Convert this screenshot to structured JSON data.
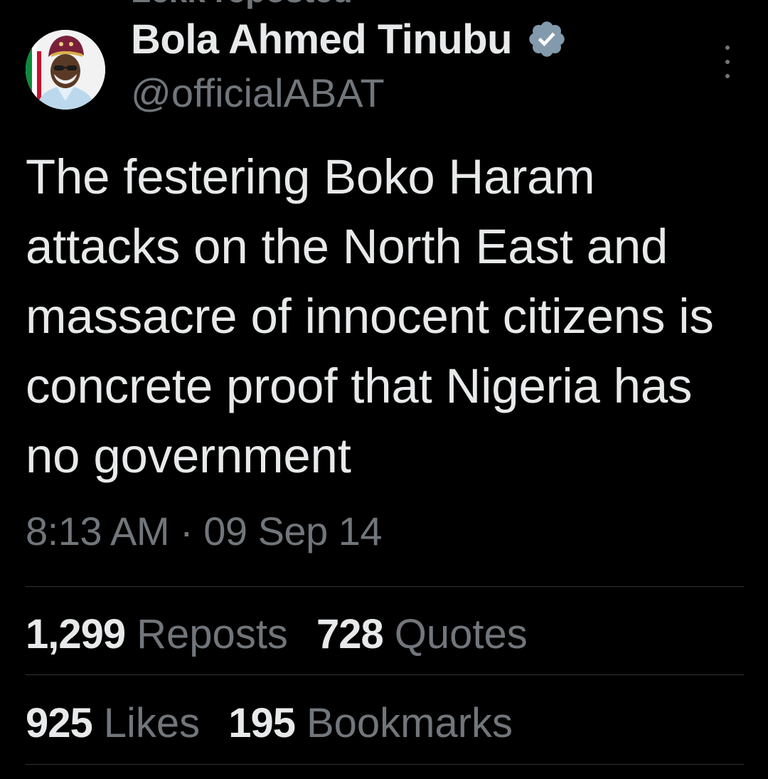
{
  "header": {
    "repost_label": "Lekk reposted"
  },
  "author": {
    "display_name": "Bola Ahmed Tinubu",
    "handle": "@officialABAT",
    "verified_icon": "verified-badge-icon",
    "verified_color": "#1d9bf0"
  },
  "tweet": {
    "text": "The festering Boko Haram attacks on the North East and massacre of innocent citizens is concrete proof that Nigeria has no government",
    "timestamp": "8:13 AM · 09 Sep 14"
  },
  "stats": {
    "reposts": {
      "count": "1,299",
      "label": "Reposts"
    },
    "quotes": {
      "count": "728",
      "label": "Quotes"
    },
    "likes": {
      "count": "925",
      "label": "Likes"
    },
    "bookmarks": {
      "count": "195",
      "label": "Bookmarks"
    }
  },
  "colors": {
    "background": "#000000",
    "primary_text": "#e7e9ea",
    "secondary_text": "#71767b",
    "divider": "#2f3336"
  }
}
